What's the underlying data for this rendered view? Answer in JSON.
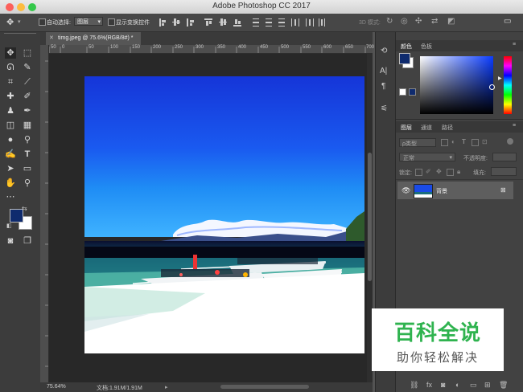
{
  "window": {
    "title": "Adobe Photoshop CC 2017",
    "traffic_colors": [
      "#fc605b",
      "#fdbc40",
      "#34c84a"
    ]
  },
  "options_bar": {
    "auto_select_label": "自动选择:",
    "auto_select_value": "图层",
    "show_transform_label": "显示变换控件",
    "mode_3d_label": "3D 模式:"
  },
  "document": {
    "tab_label": "timg.jpeg @ 75.6%(RGB/8#) *",
    "ruler_ticks": [
      "50",
      "0",
      "50",
      "100",
      "150",
      "200",
      "250",
      "300",
      "350",
      "400",
      "450",
      "500",
      "550",
      "600",
      "650",
      "700"
    ],
    "zoom": "75.64%",
    "doc_info": "文档:1.91M/1.91M"
  },
  "colors": {
    "foreground": "#0f2b6e",
    "background": "#ffffff",
    "accent_green": "#2fb34f"
  },
  "color_panel": {
    "tabs": [
      "颜色",
      "色板"
    ]
  },
  "layers_panel": {
    "tabs": [
      "图层",
      "通道",
      "路径"
    ],
    "filter_label": "ρ类型",
    "blend_mode": "正常",
    "opacity_label": "不透明度:",
    "lock_label": "锁定:",
    "fill_label": "填充:",
    "layers": [
      {
        "name": "背景",
        "visible": true,
        "locked": true
      }
    ]
  },
  "watermark": {
    "title": "百科全说",
    "subtitle": "助你轻松解决"
  }
}
